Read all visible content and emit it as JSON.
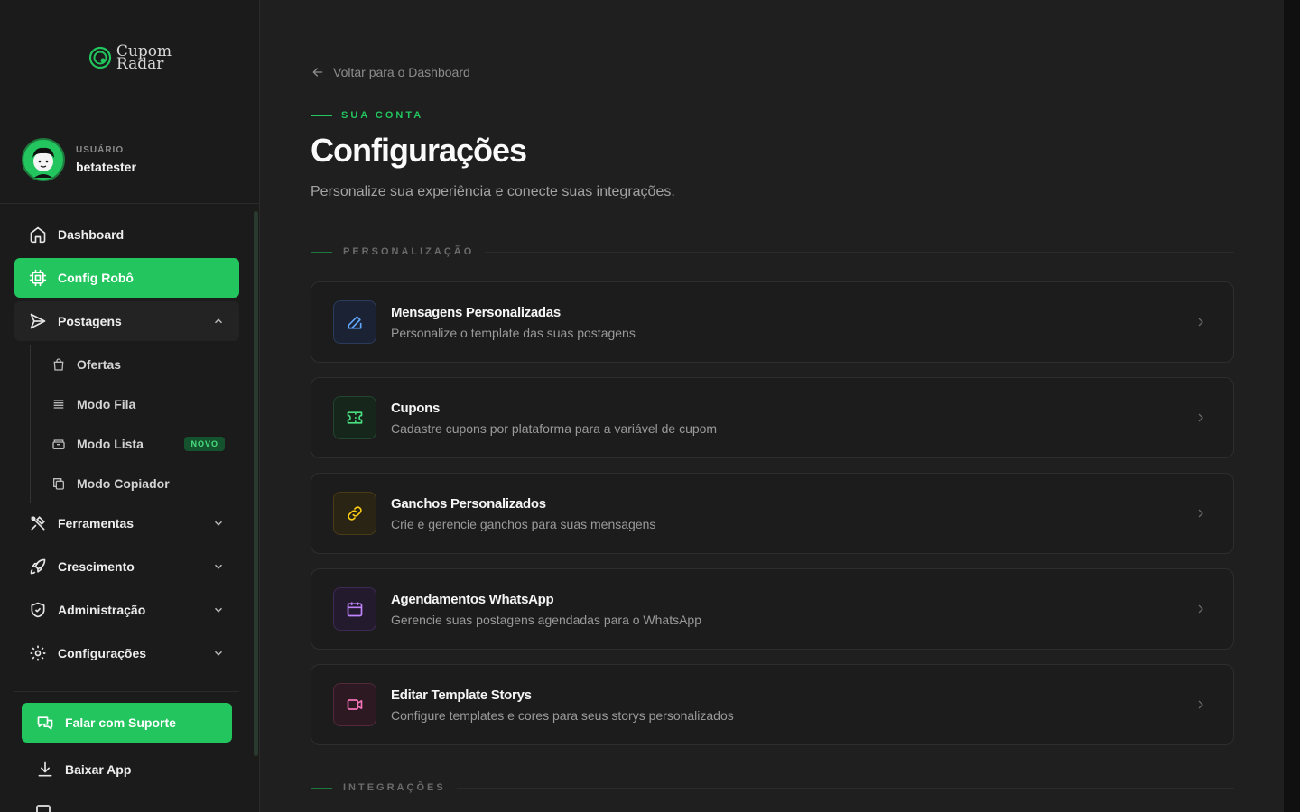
{
  "brand": {
    "line1": "Cupom",
    "line2": "Radar"
  },
  "user": {
    "label": "USUÁRIO",
    "name": "betatester"
  },
  "nav": {
    "dashboard": "Dashboard",
    "config_robo": "Config Robô",
    "postagens": "Postagens",
    "sub": {
      "ofertas": "Ofertas",
      "modo_fila": "Modo Fila",
      "modo_lista": "Modo Lista",
      "modo_lista_badge": "NOVO",
      "modo_copiador": "Modo Copiador"
    },
    "ferramentas": "Ferramentas",
    "crescimento": "Crescimento",
    "administracao": "Administração",
    "configuracoes": "Configurações"
  },
  "footer": {
    "support": "Falar com Suporte",
    "download": "Baixar App"
  },
  "page": {
    "back": "Voltar para o Dashboard",
    "eyebrow": "SUA CONTA",
    "title": "Configurações",
    "subtitle": "Personalize sua experiência e conecte suas integrações."
  },
  "sections": {
    "personalizacao": "PERSONALIZAÇÃO",
    "integracoes": "INTEGRAÇÕES"
  },
  "cards": [
    {
      "title": "Mensagens Personalizadas",
      "desc": "Personalize o template das suas postagens",
      "icon": "edit-icon",
      "color": "#3b82f6"
    },
    {
      "title": "Cupons",
      "desc": "Cadastre cupons por plataforma para a variável de cupom",
      "icon": "ticket-icon",
      "color": "#22c55e"
    },
    {
      "title": "Ganchos Personalizados",
      "desc": "Crie e gerencie ganchos para suas mensagens",
      "icon": "link-icon",
      "color": "#eab308"
    },
    {
      "title": "Agendamentos WhatsApp",
      "desc": "Gerencie suas postagens agendadas para o WhatsApp",
      "icon": "calendar-icon",
      "color": "#a855f7"
    },
    {
      "title": "Editar Template Storys",
      "desc": "Configure templates e cores para seus storys personalizados",
      "icon": "video-icon",
      "color": "#ec4899"
    }
  ],
  "colors": {
    "accent": "#22c55e",
    "bg": "#1f1f1f",
    "sidebar": "#1b1b1b"
  }
}
